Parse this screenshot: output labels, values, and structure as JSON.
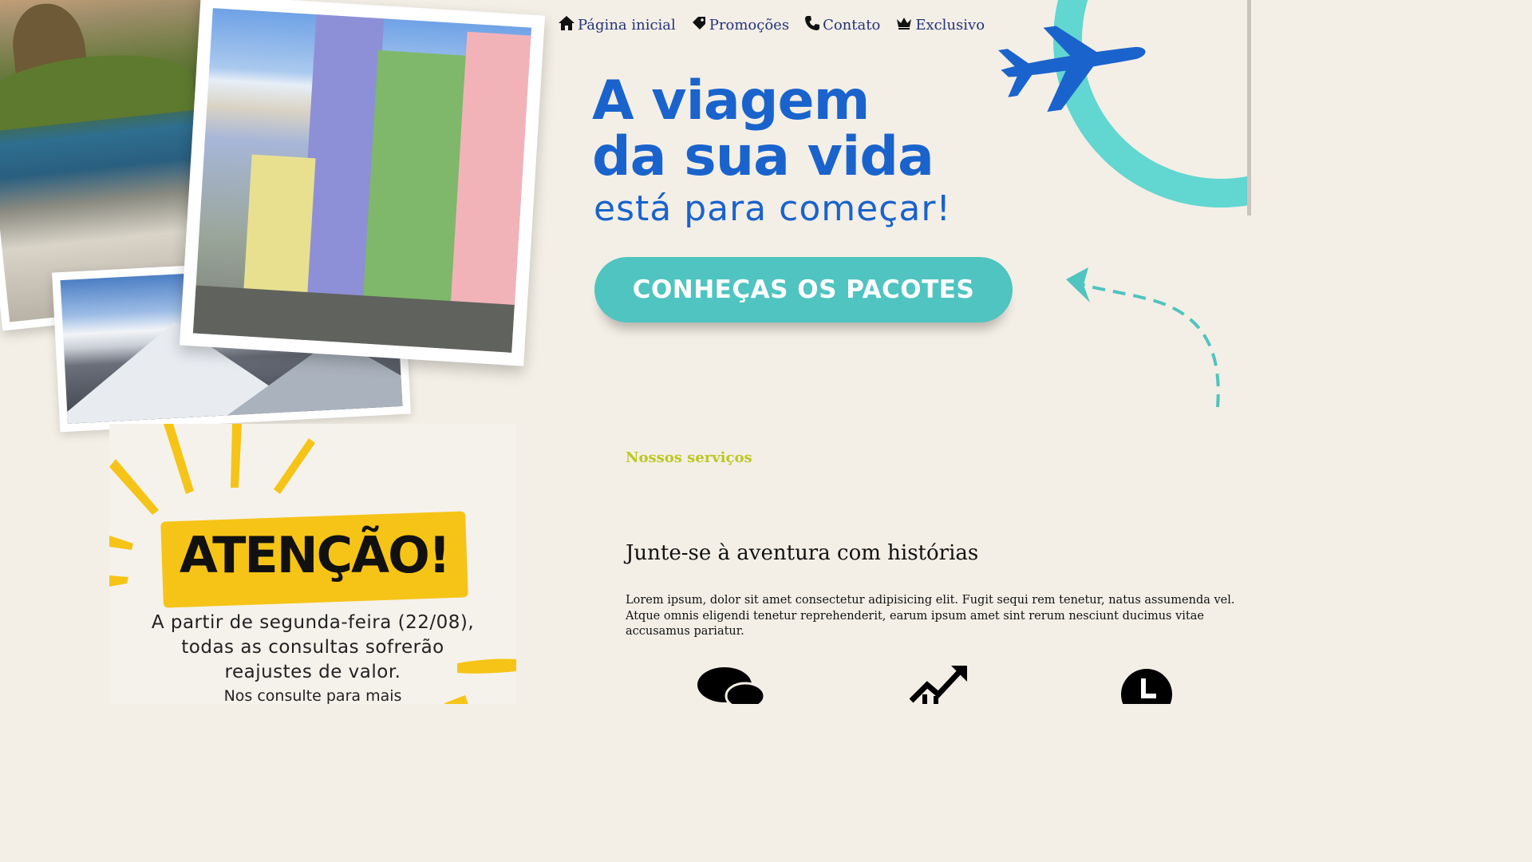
{
  "nav": {
    "items": [
      {
        "label": "Página inicial",
        "icon": "home-icon"
      },
      {
        "label": "Promoções",
        "icon": "tag-icon"
      },
      {
        "label": "Contato",
        "icon": "phone-icon"
      },
      {
        "label": "Exclusivo",
        "icon": "crown-icon"
      }
    ]
  },
  "hero": {
    "title_line1": "A viagem",
    "title_line2": "da sua vida",
    "subtitle": "está para começar!",
    "cta_label": "CONHEÇAS OS PACOTES"
  },
  "attention": {
    "title": "ATENÇÃO!",
    "text": "A partir de segunda-feira (22/08), todas as consultas sofrerão reajustes de valor.",
    "more": "Nos consulte para mais"
  },
  "services": {
    "label": "Nossos serviços",
    "title": "Junte-se à aventura com histórias",
    "description": "Lorem ipsum, dolor sit amet consectetur adipisicing elit. Fugit sequi rem tenetur, natus assumenda vel. Atque omnis eligendi tenetur reprehenderit, earum ipsum amet sint rerum nesciunt ducimus vitae accusamus pariatur.",
    "icons": [
      "chat-bubbles-icon",
      "growth-chart-icon",
      "clock-icon"
    ]
  },
  "colors": {
    "background": "#f3efe6",
    "brand_blue": "#1a63cc",
    "teal": "#4fc4c0",
    "yellow": "#f6c417",
    "accent_green": "#bcc721",
    "nav_text": "#24337a"
  }
}
